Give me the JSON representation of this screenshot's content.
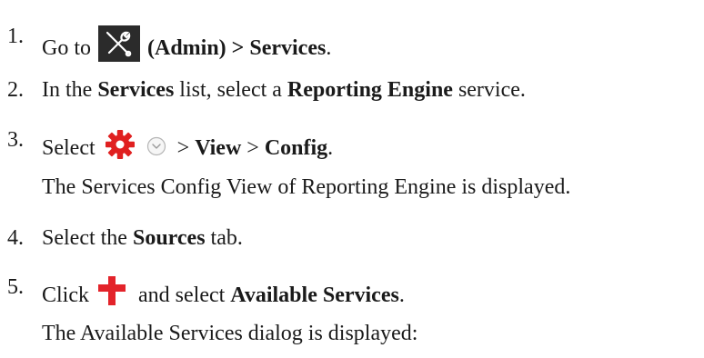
{
  "steps": [
    {
      "number": "1.",
      "go_to": "Go to",
      "admin_label": "(Admin) >",
      "services": "Services",
      "period": "."
    },
    {
      "number": "2.",
      "in_the": "In the",
      "services": "Services",
      "list_select": "list, select a",
      "reporting_engine": "Reporting Engine",
      "service": "service."
    },
    {
      "number": "3.",
      "select": "Select",
      "sep1": ">",
      "view": "View",
      "sep2": ">",
      "config": "Config",
      "period": ".",
      "note": "The Services Config View of Reporting Engine is displayed."
    },
    {
      "number": "4.",
      "select_the": "Select the",
      "sources": "Sources",
      "tab": "tab."
    },
    {
      "number": "5.",
      "click": "Click",
      "and_select": "and select",
      "available_services": "Available Services",
      "period": ".",
      "note": "The Available Services dialog is displayed:"
    }
  ],
  "icons": {
    "admin": "admin-tools-icon",
    "gear": "gear-icon",
    "chevron": "chevron-down-circle-icon",
    "add": "plus-icon"
  },
  "colors": {
    "text": "#1a1a1a",
    "admin_icon_bg": "#2b2b2b",
    "gear_red": "#e02020",
    "plus_red": "#e3232a",
    "chevron_gray": "#b0b0b0"
  }
}
